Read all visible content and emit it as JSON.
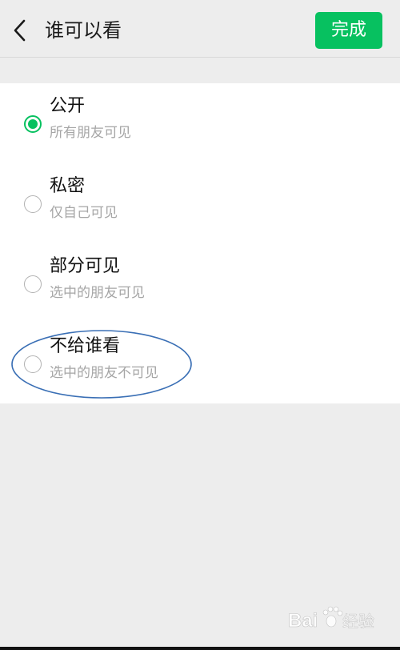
{
  "header": {
    "title": "谁可以看",
    "done_label": "完成"
  },
  "options": [
    {
      "label": "公开",
      "desc": "所有朋友可见",
      "selected": true
    },
    {
      "label": "私密",
      "desc": "仅自己可见",
      "selected": false
    },
    {
      "label": "部分可见",
      "desc": "选中的朋友可见",
      "selected": false
    },
    {
      "label": "不给谁看",
      "desc": "选中的朋友不可见",
      "selected": false
    }
  ],
  "watermark": {
    "brand": "Bai",
    "suffix": "经验"
  },
  "colors": {
    "accent": "#07c160",
    "annotation": "#3a6fb5"
  }
}
